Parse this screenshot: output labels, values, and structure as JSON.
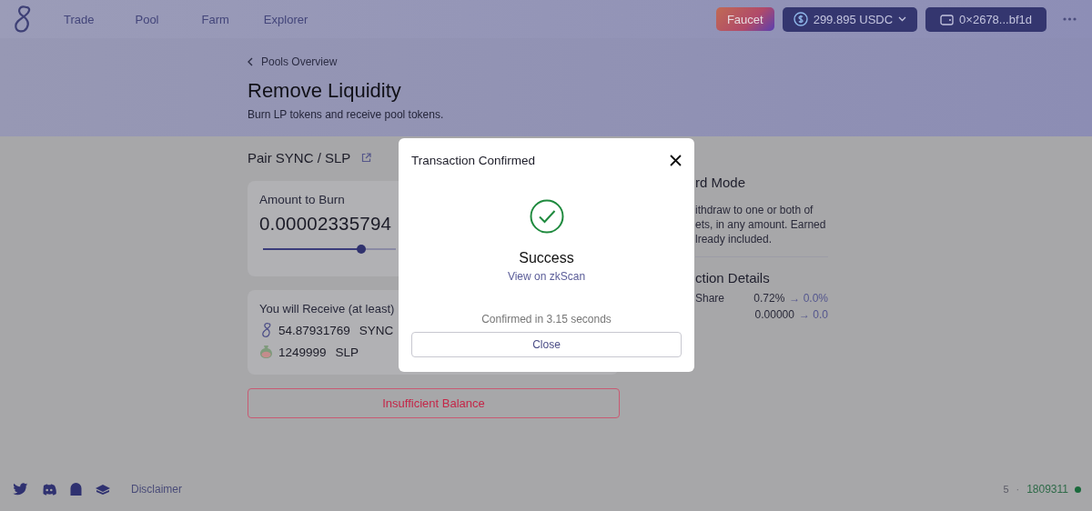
{
  "nav": {
    "items": [
      {
        "label": "Trade"
      },
      {
        "label": "Pool"
      },
      {
        "label": "Farm"
      },
      {
        "label": "Explorer"
      }
    ]
  },
  "header_actions": {
    "faucet": "Faucet",
    "balance": "299.895 USDC",
    "wallet": "0×2678...bf1d"
  },
  "page": {
    "back_link": "Pools Overview",
    "title": "Remove Liquidity",
    "subtitle": "Burn LP tokens and receive pool tokens."
  },
  "pair": {
    "label": "Pair SYNC / SLP"
  },
  "burn": {
    "label": "Amount to Burn",
    "amount": "0.00002335794",
    "level": 0.74
  },
  "receive": {
    "title": "You will Receive (at least)",
    "tokens": [
      {
        "amount": "54.87931769",
        "symbol": "SYNC",
        "kind": "sync"
      },
      {
        "amount": "1249999",
        "symbol": "SLP",
        "kind": "slp"
      }
    ]
  },
  "action_button": {
    "label": "Insufficient Balance"
  },
  "side": {
    "mode_title": "rd Mode",
    "mode_text": [
      "ithdraw to one or both of",
      "ets, in any amount. Earned",
      "lready included."
    ],
    "details_title": "ction Details",
    "details": [
      {
        "label": "Share",
        "value": "0.72%",
        "new_value": "→ 0.0%"
      },
      {
        "value": "0.00000",
        "new_value": "→ 0.0"
      }
    ]
  },
  "modal": {
    "title": "Transaction Confirmed",
    "status": "Success",
    "link": "View on zkScan",
    "note": "Confirmed in 3.15 seconds",
    "button": "Close"
  },
  "footer": {
    "link": "Disclaimer",
    "block_prefix": "5",
    "separator": "·",
    "block": "1809311"
  }
}
